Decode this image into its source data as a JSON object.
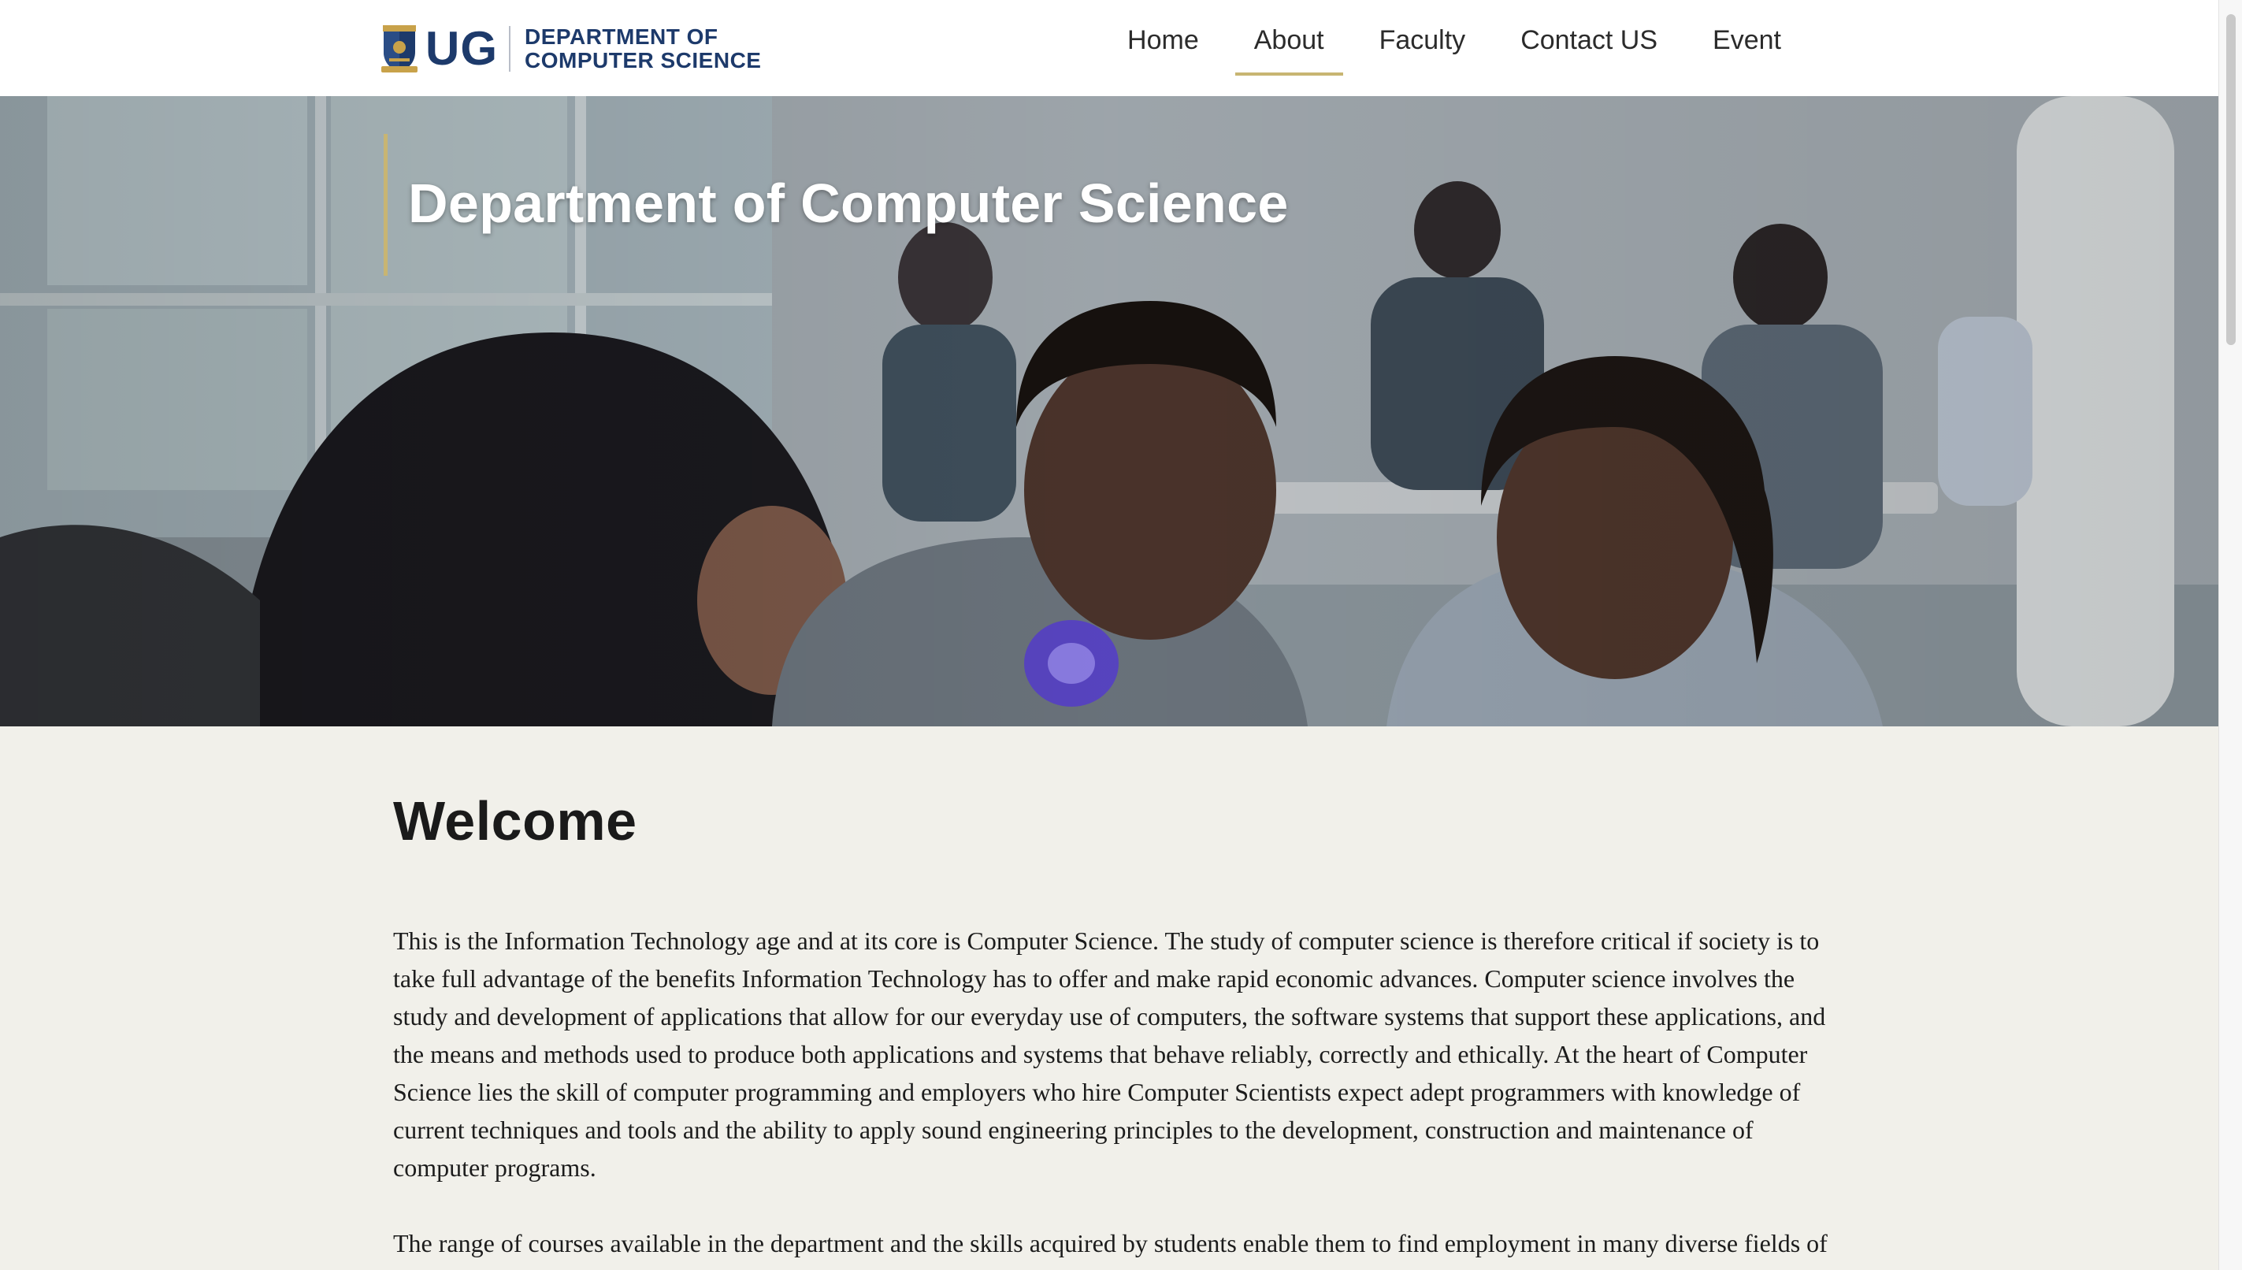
{
  "header": {
    "logo_mark": "UG",
    "logo_line1": "DEPARTMENT OF",
    "logo_line2": "COMPUTER SCIENCE",
    "nav": [
      "Home",
      "About",
      "Faculty",
      "Contact US",
      "Event"
    ],
    "active_nav": "About"
  },
  "hero": {
    "title": "Department of Computer Science"
  },
  "main": {
    "heading": "Welcome",
    "paragraph1": "This is the Information Technology age and at its core is Computer Science. The study of computer science is therefore critical if society is to take full advantage of the benefits Information Technology has to offer and make rapid economic advances.  Computer science involves the study and development of applications that allow for our everyday use of computers, the software systems that support these applications, and the means and methods used to produce both applications and systems that behave reliably, correctly and ethically. At the heart of Computer Science lies the skill of computer programming and employers who hire Computer Scientists expect adept programmers with knowledge of current techniques and tools and the ability to apply sound engineering principles to the development, construction and maintenance of computer programs.",
    "paragraph2": "The range of courses available in the department and the skills acquired by students enable them to find employment in many diverse fields of"
  },
  "colors": {
    "brand_navy": "#1d3a6b",
    "accent_gold": "#c8b572",
    "page_bg": "#f1f0ea"
  },
  "icons": {
    "logo": "university-crest-icon"
  }
}
